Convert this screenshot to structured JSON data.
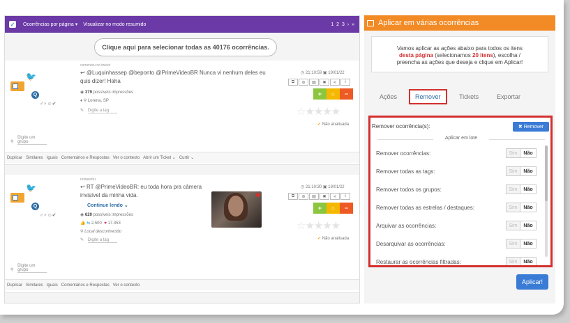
{
  "topbar": {
    "per_page": "Ocorrências por página",
    "summary_mode": "Visualizar no modo resumido",
    "pagination": "1 2 3 › »"
  },
  "select_all": "Clique aqui para selecionar todas as 40176 ocorrências.",
  "posts": [
    {
      "context": "comentou no tweet:",
      "text": "@Luquinhassep @beponto @PrimeVideoBR Nunca vi nenhum deles eu quis dizer! Haha",
      "time": "21:10:59",
      "date": "19/01/22",
      "impressions": "379",
      "impressions_label": "possíveis impressões",
      "location": "Lorena, SP",
      "tag_placeholder": "Digite a tag",
      "group_placeholder": "Digite um grupo",
      "status": "Não analisada"
    },
    {
      "context": "retweetou:",
      "text": "RT @PrimeVideoBR: eu toda hora pra câmera invisível da minha vida.",
      "link": "Continue lendo ⌄",
      "time": "21:10:30",
      "date": "19/01/22",
      "impressions": "620",
      "impressions_label": "possíveis impressões",
      "retweets": "2.500",
      "likes": "17.353",
      "location": "Local desconhecido",
      "tag_placeholder": "Digite a tag",
      "group_placeholder": "Digite um grupo",
      "status": "Não analisada"
    }
  ],
  "actions1": [
    "Duplicar",
    "Similares",
    "Iguais",
    "Comentários e Respostas",
    "Ver o contexto",
    "Abrir um Ticket ⌄",
    "Curtir ⌄"
  ],
  "actions2": [
    "Duplicar",
    "Similares",
    "Iguais",
    "Comentários e Respostas",
    "Ver o contexto"
  ],
  "right": {
    "title": "Aplicar em várias ocorrências",
    "info_1": "Vamos aplicar as ações abaixo para todos os itens",
    "info_hl_1": "desta página",
    "info_2": "(selecionamos",
    "info_hl_2": "20 itens",
    "info_3": "), escolha /",
    "info_4": "preencha as ações que deseja e clique em Aplicar!",
    "tabs": [
      "Ações",
      "Remover",
      "Tickets",
      "Exportar"
    ],
    "remove_title": "Remover ocorrência(s):",
    "remove_btn": "✖ Remover",
    "batch_label": "Aplicar em lote",
    "rows": [
      "Remover ocorrências:",
      "Remover todas as tags:",
      "Remover todos os grupos:",
      "Remover todas as estrelas / destaques:",
      "Arquivar as ocorrências:",
      "Desarquivar as ocorrências:",
      "Restaurar as ocorrências filtradas:"
    ],
    "sim": "Sim",
    "nao": "Não",
    "apply": "Aplicar!"
  },
  "colors": {
    "topbar": "#6b3aa6",
    "header": "#f28b25",
    "highlight": "#d32f2f",
    "primary": "#3a7bd5"
  }
}
